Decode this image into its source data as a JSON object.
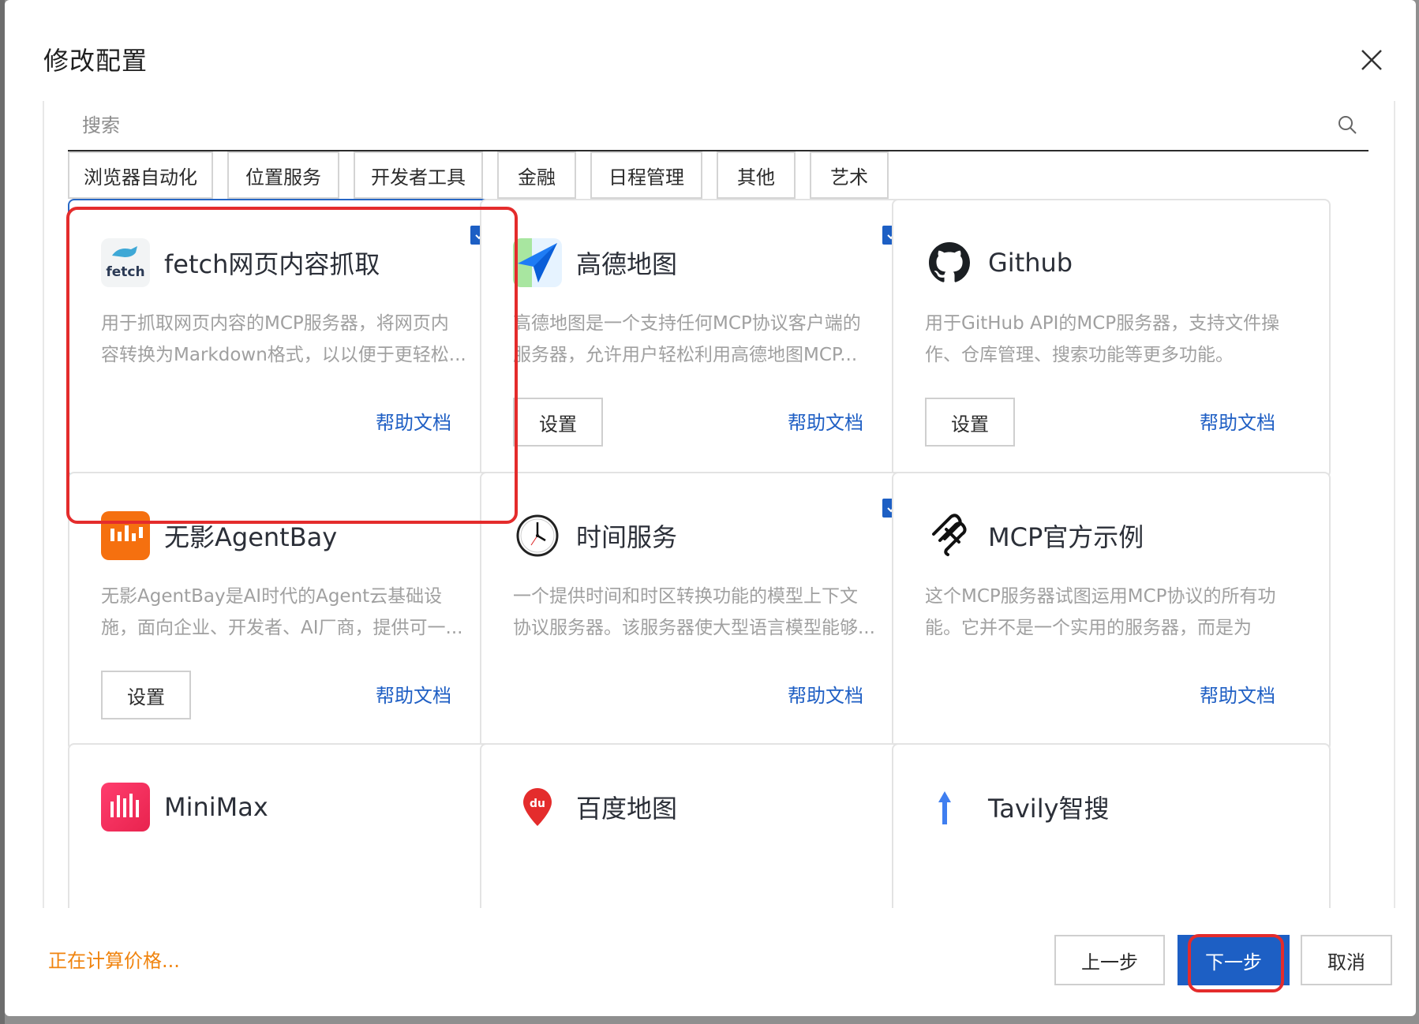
{
  "modal": {
    "title": "修改配置"
  },
  "search": {
    "placeholder": "搜索"
  },
  "tabs": [
    "浏览器自动化",
    "位置服务",
    "开发者工具",
    "金融",
    "日程管理",
    "其他",
    "艺术"
  ],
  "cards": [
    {
      "title": "fetch网页内容抓取",
      "desc_line1": "用于抓取网页内容的MCP服务器，将网页内",
      "desc_line2": "容转换为Markdown格式，以以便于更轻松...",
      "help": "帮助文档",
      "checked": true,
      "logo_text": "fetch"
    },
    {
      "title": "高德地图",
      "desc_line1": "高德地图是一个支持任何MCP协议客户端的",
      "desc_line2": "服务器，允许用户轻松利用高德地图MCP...",
      "settings": "设置",
      "help": "帮助文档",
      "checked": true
    },
    {
      "title": "Github",
      "desc_line1": "用于GitHub API的MCP服务器，支持文件操",
      "desc_line2": "作、仓库管理、搜索功能等更多功能。",
      "settings": "设置",
      "help": "帮助文档",
      "checked": false
    },
    {
      "title": "无影AgentBay",
      "desc_line1": "无影AgentBay是AI时代的Agent云基础设",
      "desc_line2": "施，面向企业、开发者、AI厂商，提供可一...",
      "settings": "设置",
      "help": "帮助文档",
      "checked": false
    },
    {
      "title": "时间服务",
      "desc_line1": "一个提供时间和时区转换功能的模型上下文",
      "desc_line2": "协议服务器。该服务器使大型语言模型能够...",
      "help": "帮助文档",
      "checked": true
    },
    {
      "title": "MCP官方示例",
      "desc_line1": "这个MCP服务器试图运用MCP协议的所有功",
      "desc_line2": "能。它并不是一个实用的服务器，而是为",
      "help": "帮助文档",
      "checked": false
    },
    {
      "title": "MiniMax"
    },
    {
      "title": "百度地图",
      "logo_text": "du"
    },
    {
      "title": "Tavily智搜"
    }
  ],
  "footer": {
    "status": "正在计算价格...",
    "prev": "上一步",
    "next": "下一步",
    "cancel": "取消"
  },
  "colors": {
    "primary": "#1d5fc4",
    "highlight": "#e42c2c",
    "status": "#f0840f"
  }
}
